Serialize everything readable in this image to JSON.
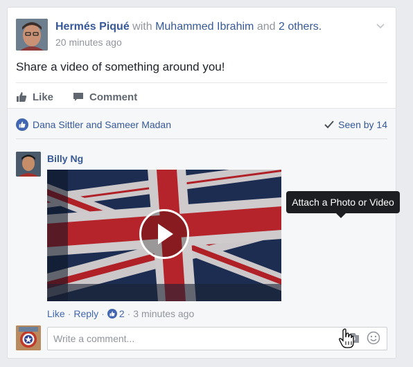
{
  "post": {
    "author": "Hermés Piqué",
    "with_text": "with",
    "tagged": "Muhammed Ibrahim",
    "and_text": "and",
    "others": "2 others.",
    "timestamp": "20 minutes ago",
    "text": "Share a video of something around you!",
    "menu_icon": "chevron-down-icon"
  },
  "actions": {
    "like_label": "Like",
    "comment_label": "Comment"
  },
  "reactions": {
    "names": "Dana Sittler and Sameer Madan",
    "seen": "Seen by 14"
  },
  "comment": {
    "author": "Billy Ng",
    "attachment": "video",
    "like_label": "Like",
    "reply_label": "Reply",
    "like_count": "2",
    "time": "3 minutes ago"
  },
  "composer": {
    "placeholder": "Write a comment...",
    "tooltip": "Attach a Photo or Video"
  },
  "colors": {
    "link": "#365899",
    "brand": "#4267b2",
    "muted": "#90949c",
    "background": "#e9ebee"
  }
}
